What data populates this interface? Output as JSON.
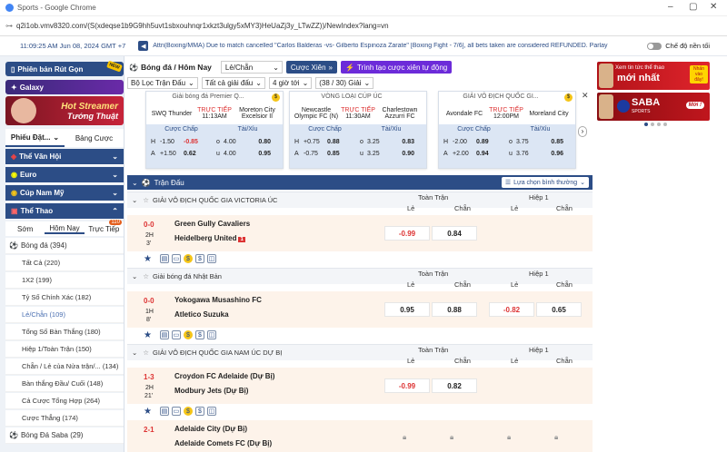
{
  "window": {
    "title": "Sports - Google Chrome",
    "url": "q2i1ob.vmv8320.com/(S(xdeqse1b9G9hh5uvt1sbxouhnqr1xkzt3ulgy5xMY3)HeUaZj3y_LTwZZ))/NewIndex?lang=vn"
  },
  "header": {
    "datetime": "11:09:25 AM Jun 08, 2024 GMT +7",
    "ticker": "Attn(Boxing/MMA) Due to match cancelled \"Carlos Balderas -vs- Gilberto Espinoza Zarate\" [Boxing Fight - 7/6], all bets taken are considered REFUNDED. Parlay",
    "night_mode": "Chế độ nền tối"
  },
  "toolbar": {
    "sport": "Bóng đá / Hôm Nay",
    "odds_type": "Lẻ/Chẵn",
    "parlay_btn": "Cược Xiên",
    "create_parlay": "Trình tạo cược xiên tự động",
    "filter": "Bộ Lọc Trận Đấu",
    "all_leagues": "Tất cả giải đấu",
    "hours": "4 giờ tới",
    "league_count": "(38 / 30) Giải"
  },
  "left": {
    "banner1": "Phiên bản Rút Gọn",
    "banner2": "Galaxy",
    "banner3_l1": "Hot Streamer",
    "banner3_l2": "Tướng Thuật",
    "tab_bet": "Phiếu Đặt...",
    "tab_table": "Bảng Cược",
    "cats": [
      "Thể Văn Hội",
      "Euro",
      "Cúp Nam Mỹ",
      "Thể Thao"
    ],
    "sub": [
      "Sớm",
      "Hôm Nay",
      "Trực Tiếp"
    ],
    "live_count": "110",
    "items": [
      {
        "label": "Bóng đá (394)"
      },
      {
        "label": "Tất Cả (220)"
      },
      {
        "label": "1X2 (199)"
      },
      {
        "label": "Tỷ Số Chính Xác (182)"
      },
      {
        "label": "Lẻ/Chẵn (109)"
      },
      {
        "label": "Tổng Số Bàn Thắng (180)"
      },
      {
        "label": "Hiệp 1/Toàn Trận (150)"
      },
      {
        "label": "Chẵn / Lẻ của Nửa trận/... (134)"
      },
      {
        "label": "Bàn thắng Đầu/ Cuối (148)"
      },
      {
        "label": "Cả Cược Tổng Hợp (264)"
      },
      {
        "label": "Cược Thẳng (174)"
      },
      {
        "label": "Bóng Đá Saba (29)"
      }
    ]
  },
  "cards": [
    {
      "league": "Giải bóng đá Premier Q...",
      "home": "SWQ Thunder",
      "away": "Moreton City Excelsior II",
      "status": "TRỰC TIẾP",
      "time": "11:13AM",
      "hdc": "Cược Chấp",
      "ou": "Tài/Xỉu",
      "r1": [
        "H",
        "-1.50",
        "-0.85",
        "o",
        "4.00",
        "0.80"
      ],
      "r2": [
        "A",
        "+1.50",
        "0.62",
        "u",
        "4.00",
        "0.95"
      ]
    },
    {
      "league": "VÒNG LOẠI CÚP ÚC",
      "home": "Newcastle Olympic FC (N)",
      "away": "Charlestown Azzurri FC",
      "status": "TRỰC TIẾP",
      "time": "11:30AM",
      "hdc": "Cược Chấp",
      "ou": "Tài/Xỉu",
      "r1": [
        "H",
        "+0.75",
        "0.88",
        "o",
        "3.25",
        "0.83"
      ],
      "r2": [
        "A",
        "-0.75",
        "0.85",
        "u",
        "3.25",
        "0.90"
      ]
    },
    {
      "league": "GIẢI VÔ ĐỊCH QUỐC GI...",
      "home": "Avondale FC",
      "away": "Moreland City",
      "status": "TRỰC TIẾP",
      "time": "12:00PM",
      "hdc": "Cược Chấp",
      "ou": "Tài/Xỉu",
      "r1": [
        "H",
        "-2.00",
        "0.89",
        "o",
        "3.75",
        "0.85"
      ],
      "r2": [
        "A",
        "+2.00",
        "0.94",
        "u",
        "3.76",
        "0.96"
      ]
    }
  ],
  "table": {
    "title": "Trận Đấu",
    "sort": "Lựa chọn bình thường",
    "full": "Toàn Trận",
    "half": "Hiệp 1",
    "odd": "Lẻ",
    "even": "Chẵn"
  },
  "sections": [
    {
      "league": "GIẢI VÔ ĐỊCH QUỐC GIA VICTORIA ÚC",
      "score": "0-0",
      "period": "2H",
      "minute": "3'",
      "home": "Green Gully Cavaliers",
      "away": "Heidelberg United",
      "card": "1",
      "odd": "-0.99",
      "even": "0.84",
      "h_odd": "",
      "h_even": ""
    },
    {
      "league": "Giải bóng đá Nhật Bản",
      "score": "0-0",
      "period": "1H",
      "minute": "8'",
      "home": "Yokogawa Musashino FC",
      "away": "Atletico Suzuka",
      "card": "",
      "odd": "0.95",
      "even": "0.88",
      "h_odd": "-0.82",
      "h_even": "0.65"
    },
    {
      "league": "GIẢI VÔ ĐỊCH QUỐC GIA NAM ÚC DỰ BỊ",
      "score": "1-3",
      "period": "2H",
      "minute": "21'",
      "home": "Croydon FC Adelaide (Dự Bị)",
      "away": "Modbury Jets (Dự Bị)",
      "card": "",
      "odd": "-0.99",
      "even": "0.82",
      "h_odd": "",
      "h_even": ""
    },
    {
      "league": "",
      "score": "2-1",
      "period": "",
      "minute": "",
      "home": "Adelaide City (Dự Bị)",
      "away": "Adelaide Comets FC (Dự Bị)",
      "card": "",
      "odd": "",
      "even": "",
      "h_odd": "",
      "h_even": ""
    }
  ],
  "right": {
    "ad1_l1": "Xem tin tức thể thao",
    "ad1_l2": "mới nhất",
    "ad1_badge": "Nhấn vào đây!",
    "ad2_brand": "SABA",
    "ad2_sub": "SPORTS",
    "ad2_new": "Mới !"
  }
}
